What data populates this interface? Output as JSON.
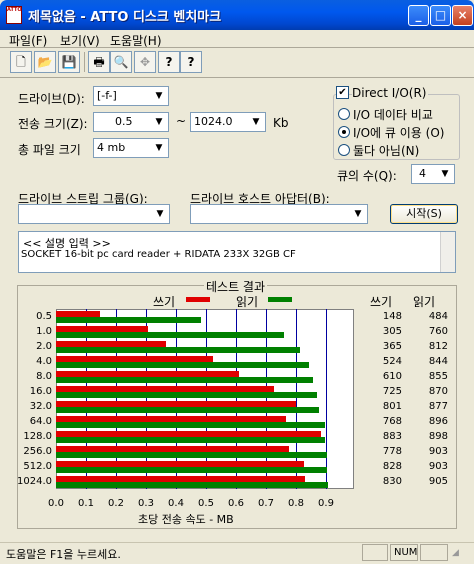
{
  "window": {
    "title": "제목없음 - ATTO 디스크 벤치마크",
    "app_icon_text": "ATTO"
  },
  "titlebar_buttons": {
    "minimize": "_",
    "maximize": "□",
    "close": "×"
  },
  "menu": [
    "파일(F)",
    "보기(V)",
    "도움말(H)"
  ],
  "toolbar": {
    "icons": [
      "new-file-icon",
      "open-folder-icon",
      "save-icon",
      "print-icon",
      "print-preview-icon",
      "move-icon",
      "help-icon",
      "context-help-icon"
    ],
    "glyphs": [
      "🗋",
      "📂",
      "💾",
      "🖶",
      "🔍",
      "✥",
      "?",
      "?"
    ]
  },
  "form": {
    "drive_label": "드라이브(D):",
    "drive_value": "[-f-]",
    "transfer_label": "전송 크기(Z):",
    "transfer_from": "0.5",
    "tilde": "~",
    "transfer_to": "1024.0",
    "transfer_unit": "Kb",
    "total_label": "총 파일 크기",
    "total_value": "4 mb",
    "direct_io_label": "Direct I/O(R)",
    "direct_io_checked": true,
    "radio_options": [
      "I/O 데이타 비교",
      "I/O에 큐 이용 (O)",
      "둘다 아님(N)"
    ],
    "radio_selected": 1,
    "queue_label": "큐의 수(Q):",
    "queue_value": "4",
    "stripe_label": "드라이브 스트립 그룹(G):",
    "adapter_label": "드라이브 호스트 아답터(B):",
    "start_button": "시작(S)",
    "arrow": "▼"
  },
  "description": {
    "line1": "<< 설명 입력 >>",
    "line2": "SOCKET 16-bit pc card reader + RIDATA 233X 32GB CF"
  },
  "colors": {
    "write": "#e00000",
    "read": "#008000",
    "grid": "#0000a0"
  },
  "chart_data": {
    "type": "bar",
    "title": "테스트 결과",
    "legend": {
      "write": "쓰기",
      "read": "읽기"
    },
    "column_headers": {
      "write": "쓰기",
      "read": "읽기"
    },
    "categories": [
      "0.5",
      "1.0",
      "2.0",
      "4.0",
      "8.0",
      "16.0",
      "32.0",
      "64.0",
      "128.0",
      "256.0",
      "512.0",
      "1024.0"
    ],
    "series": [
      {
        "name": "쓰기",
        "values": [
          148,
          305,
          365,
          524,
          610,
          725,
          801,
          768,
          883,
          778,
          828,
          830
        ]
      },
      {
        "name": "읽기",
        "values": [
          484,
          760,
          812,
          844,
          855,
          870,
          877,
          896,
          898,
          903,
          903,
          905
        ]
      }
    ],
    "xlim": [
      0,
      1.0
    ],
    "xticks": [
      "0.0",
      "0.1",
      "0.2",
      "0.3",
      "0.4",
      "0.5",
      "0.6",
      "0.7",
      "0.8",
      "0.9"
    ],
    "xlabel": "초당 전송 속도 - MB",
    "grid": true
  },
  "statusbar": {
    "help_text": "도움말은 F1을 누르세요.",
    "num": "NUM"
  }
}
